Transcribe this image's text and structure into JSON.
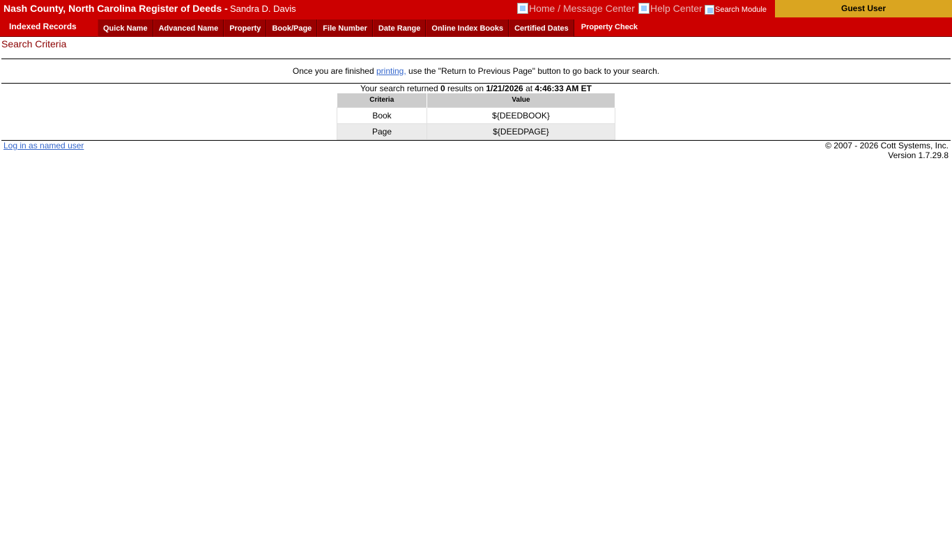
{
  "header": {
    "title": "Nash County, North Carolina Register of Deeds -",
    "official": "Sandra D. Davis",
    "home_link": "Home / Message Center",
    "help_link": "Help Center",
    "search_module": "Search Module",
    "guest": "Guest User"
  },
  "nav": {
    "section": "Indexed Records",
    "tabs": [
      "Quick Name",
      "Advanced Name",
      "Property",
      "Book/Page",
      "File Number",
      "Date Range",
      "Online Index Books",
      "Certified Dates",
      "Property Check"
    ]
  },
  "content": {
    "title": "Search Criteria",
    "notice_before": "Once you are finished ",
    "notice_link": "printing,",
    "notice_after": " use the \"Return to Previous Page\" button to go back to your search.",
    "results_prefix": "Your search returned ",
    "results_count": "0",
    "results_mid": " results on ",
    "results_date": "1/21/2026",
    "results_at": " at ",
    "results_time": "4:46:33 AM ET",
    "table": {
      "headers": [
        "Criteria",
        "Value"
      ],
      "rows": [
        [
          "Book",
          "${DEEDBOOK}"
        ],
        [
          "Page",
          "${DEEDPAGE}"
        ]
      ]
    }
  },
  "footer": {
    "login_link": "Log in as named user",
    "copyright": "© 2007 - 2026 Cott Systems, Inc.",
    "version": "Version 1.7.29.8"
  }
}
